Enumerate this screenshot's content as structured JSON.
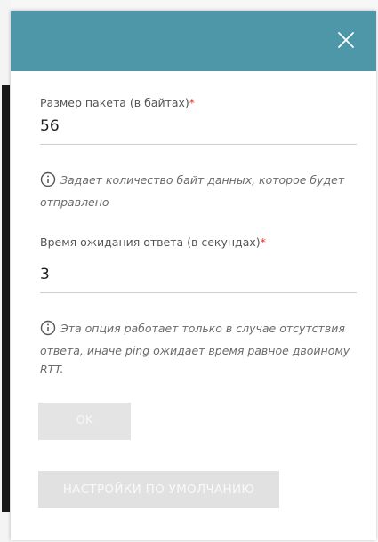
{
  "field_packet_size": {
    "label": "Размер пакета (в байтах)",
    "required_mark": "*",
    "value": "56",
    "hint": "Задает количество байт данных, которое будет отправлено"
  },
  "field_timeout": {
    "label": "Время ожидания ответа (в секундах)",
    "required_mark": "*",
    "value": "3",
    "hint": "Эта опция работает только в случае отсутствия ответа, иначе ping ожидает время равное двойному RTT."
  },
  "buttons": {
    "ok_label": "OK",
    "defaults_label": "НАСТРОЙКИ ПО УМОЛЧАНИЮ"
  },
  "colors": {
    "header": "#4d97a9",
    "required": "#e8342a",
    "button_disabled": "#e4e4e4"
  },
  "icons": {
    "close": "close-icon",
    "info": "info-icon"
  }
}
